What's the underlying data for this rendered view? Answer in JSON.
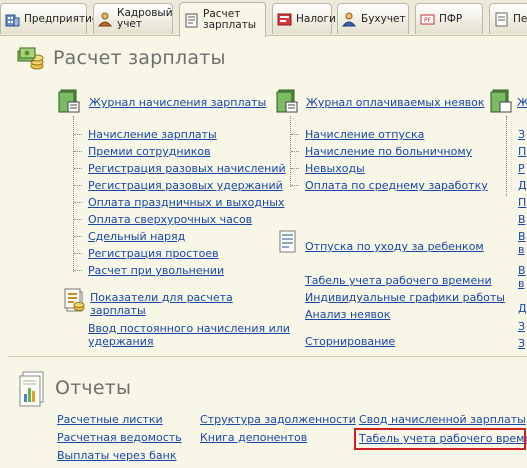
{
  "tabs": [
    {
      "label": "Предприятие",
      "icon": "building-icon"
    },
    {
      "label": "Кадровый учет",
      "line1": "Кадровый",
      "line2": "учет",
      "icon": "personnel-icon"
    },
    {
      "label": "Расчет зарплаты",
      "line1": "Расчет",
      "line2": "зарплаты",
      "icon": "payroll-icon"
    },
    {
      "label": "Налоги",
      "icon": "tax-icon"
    },
    {
      "label": "Бухучет",
      "icon": "accounting-icon"
    },
    {
      "label": "ПФР",
      "icon": "pension-fund-icon"
    },
    {
      "label": "Пе",
      "icon": "personalized-icon"
    }
  ],
  "active_tab": "Расчет зарплаты",
  "section_payroll": {
    "title": "Расчет зарплаты",
    "col1": {
      "journal": "Журнал начисления зарплаты",
      "items": [
        "Начисление зарплаты",
        "Премии сотрудников",
        "Регистрация разовых начислений",
        "Регистрация разовых удержаний",
        "Оплата праздничных и выходных",
        "Оплата сверхурочных часов",
        "Сдельный наряд",
        "Регистрация простоев",
        "Расчет при увольнении"
      ],
      "indicators": "Показатели для расчета зарплаты",
      "indicators_line1": "Показатели для расчета",
      "indicators_line2": "зарплаты",
      "permanent": "Ввод постоянного начисления или удержания",
      "permanent_line1": "Ввод постоянного начисления или",
      "permanent_line2": "удержания"
    },
    "col2": {
      "journal": "Журнал оплачиваемых неявок",
      "items": [
        "Начисление отпуска",
        "Начисление по больничному",
        "Невыходы",
        "Оплата по среднему заработку"
      ],
      "childcare": "Отпуска по уходу за ребенком",
      "timesheet": "Табель учета рабочего времени",
      "schedules": "Индивидуальные графики работы",
      "absence_analysis": "Анализ неявок",
      "reversal": "Сторнирование"
    },
    "col3_partial": [
      "Ж",
      "З",
      "П",
      "Р",
      "Д",
      "П",
      "В",
      "В",
      "в",
      "В",
      "в",
      "Д",
      "З",
      "З"
    ]
  },
  "section_reports": {
    "title": "Отчеты",
    "col1": [
      "Расчетные листки",
      "Расчетная ведомость",
      "Выплаты через банк"
    ],
    "col2": [
      "Структура задолженности",
      "Книга депонентов"
    ],
    "col3": [
      "Свод начисленной зарплаты",
      "Табель учета рабочего времени"
    ]
  },
  "colors": {
    "background": "#f7f6e7",
    "link": "#1848a8",
    "highlight": "#d12020",
    "heading": "#6f6f6f"
  }
}
